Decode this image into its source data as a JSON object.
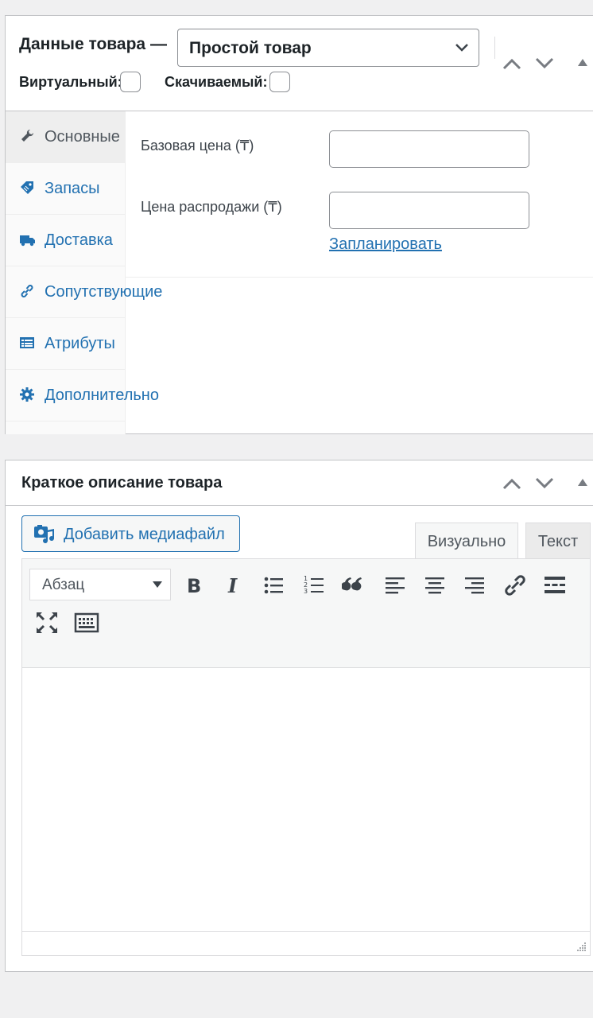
{
  "product_data": {
    "title": "Данные товара —",
    "type_select": "Простой товар",
    "virtual_label": "Виртуальный:",
    "downloadable_label": "Скачиваемый:",
    "tabs": [
      {
        "label": "Основные",
        "icon": "wrench-icon"
      },
      {
        "label": "Запасы",
        "icon": "tag-icon"
      },
      {
        "label": "Доставка",
        "icon": "truck-icon"
      },
      {
        "label": "Сопутствующие",
        "icon": "link-icon"
      },
      {
        "label": "Атрибуты",
        "icon": "list-icon"
      },
      {
        "label": "Дополнительно",
        "icon": "gear-icon"
      }
    ],
    "regular_price_label": "Базовая цена (₸)",
    "sale_price_label": "Цена распродажи (₸)",
    "schedule_link": "Запланировать"
  },
  "short_description": {
    "title": "Краткое описание товара",
    "add_media": "Добавить медиафайл",
    "tab_visual": "Визуально",
    "tab_text": "Текст",
    "format_select": "Абзац"
  }
}
